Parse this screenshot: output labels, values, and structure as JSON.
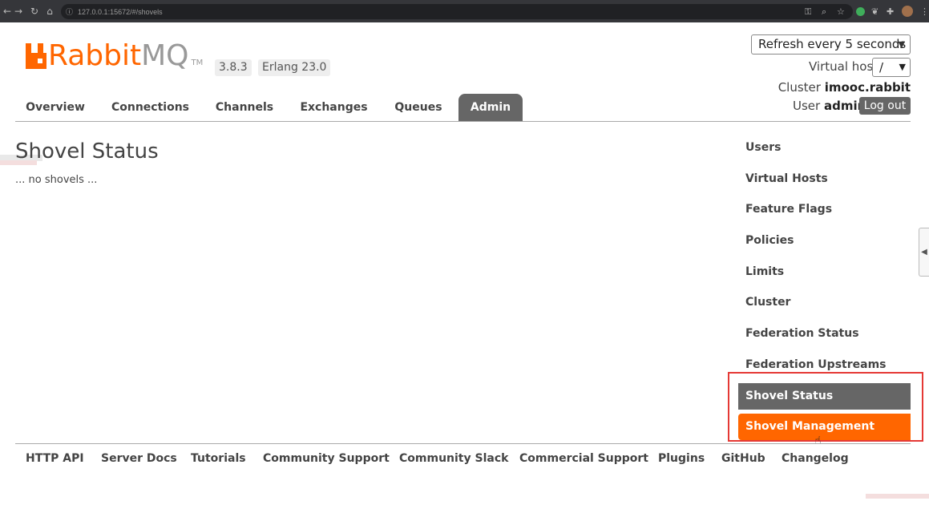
{
  "browser": {
    "url_host": "127.0.0.1",
    "url_path": ":15672/#/shovels"
  },
  "logo": {
    "rabbit": "Rabbit",
    "mq": "MQ",
    "tm": "TM"
  },
  "badges": {
    "version": "3.8.3",
    "erlang": "Erlang 23.0"
  },
  "header": {
    "refresh_value": "Refresh every 5 seconds",
    "vhost_label": "Virtual host",
    "vhost_value": "/",
    "cluster_label": "Cluster",
    "cluster_name": "imooc.rabbit",
    "user_label": "User",
    "user_name": "admin",
    "logout_label": "Log out"
  },
  "tabs": [
    "Overview",
    "Connections",
    "Channels",
    "Exchanges",
    "Queues",
    "Admin"
  ],
  "active_tab": "Admin",
  "main": {
    "title": "Shovel Status",
    "empty_message": "... no shovels ..."
  },
  "admin_menu": [
    "Users",
    "Virtual Hosts",
    "Feature Flags",
    "Policies",
    "Limits",
    "Cluster",
    "Federation Status",
    "Federation Upstreams",
    "Shovel Status",
    "Shovel Management"
  ],
  "admin_menu_selected": "Shovel Status",
  "admin_menu_hovered": "Shovel Management",
  "footer_links": [
    "HTTP API",
    "Server Docs",
    "Tutorials",
    "Community Support",
    "Community Slack",
    "Commercial Support",
    "Plugins",
    "GitHub",
    "Changelog"
  ],
  "colors": {
    "brand": "#ff6600",
    "tab_active": "#666666",
    "highlight": "#e53935"
  }
}
